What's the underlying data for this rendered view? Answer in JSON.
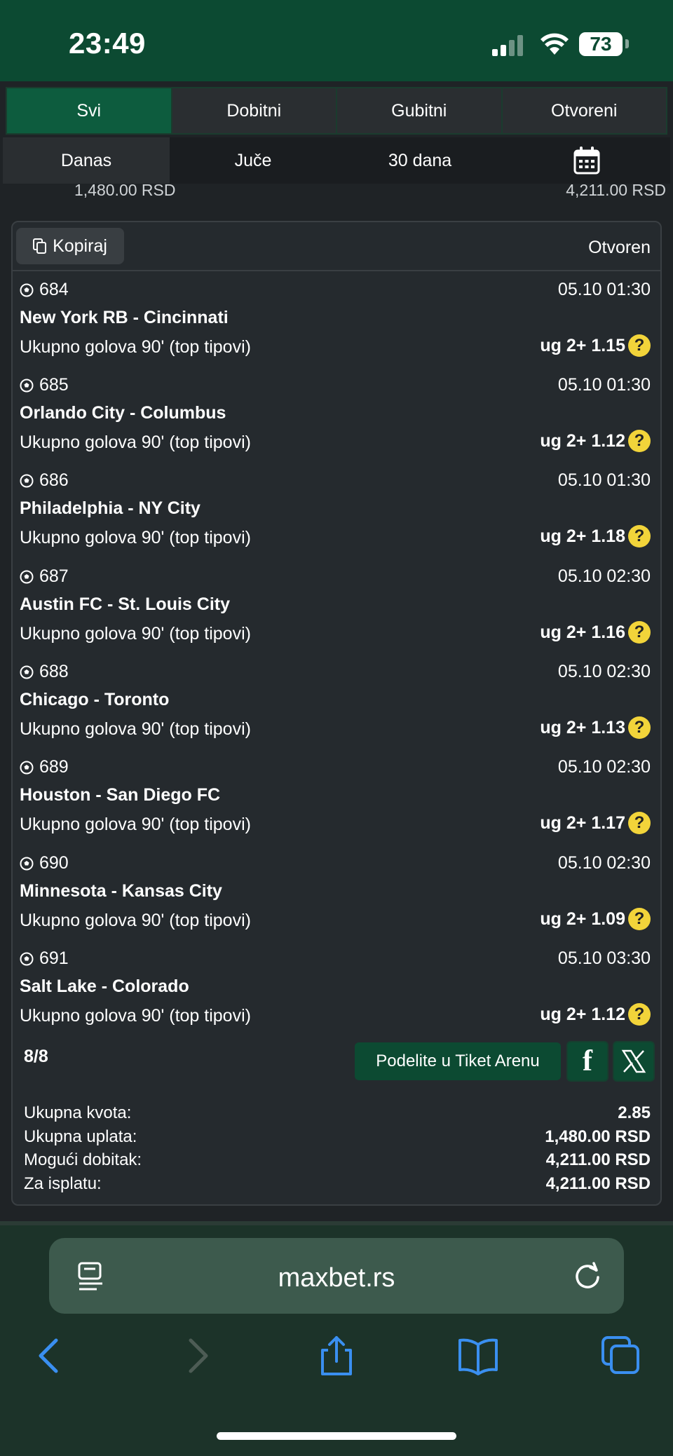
{
  "status_bar": {
    "time": "23:49",
    "battery": "73"
  },
  "tabs": [
    {
      "label": "Svi",
      "active": true
    },
    {
      "label": "Dobitni",
      "active": false
    },
    {
      "label": "Gubitni",
      "active": false
    },
    {
      "label": "Otvoreni",
      "active": false
    }
  ],
  "periods": [
    {
      "label": "Danas"
    },
    {
      "label": "Juče"
    },
    {
      "label": "30 dana"
    }
  ],
  "clipped_amounts": {
    "left": "1,480.00 RSD",
    "right": "4,211.00 RSD"
  },
  "ticket": {
    "copy_label": "Kopiraj",
    "status": "Otvoren",
    "matches": [
      {
        "id": "684",
        "date": "05.10 01:30",
        "teams": "New York RB - Cincinnati",
        "market": "Ukupno golova 90' (top tipovi)",
        "tip": "ug 2+ 1.15"
      },
      {
        "id": "685",
        "date": "05.10 01:30",
        "teams": "Orlando City - Columbus",
        "market": "Ukupno golova 90' (top tipovi)",
        "tip": "ug 2+ 1.12"
      },
      {
        "id": "686",
        "date": "05.10 01:30",
        "teams": "Philadelphia - NY City",
        "market": "Ukupno golova 90' (top tipovi)",
        "tip": "ug 2+ 1.18"
      },
      {
        "id": "687",
        "date": "05.10 02:30",
        "teams": "Austin FC - St. Louis City",
        "market": "Ukupno golova 90' (top tipovi)",
        "tip": "ug 2+ 1.16"
      },
      {
        "id": "688",
        "date": "05.10 02:30",
        "teams": "Chicago - Toronto",
        "market": "Ukupno golova 90' (top tipovi)",
        "tip": "ug 2+ 1.13"
      },
      {
        "id": "689",
        "date": "05.10 02:30",
        "teams": "Houston - San Diego FC",
        "market": "Ukupno golova 90' (top tipovi)",
        "tip": "ug 2+ 1.17"
      },
      {
        "id": "690",
        "date": "05.10 02:30",
        "teams": "Minnesota - Kansas City",
        "market": "Ukupno golova 90' (top tipovi)",
        "tip": "ug 2+ 1.09"
      },
      {
        "id": "691",
        "date": "05.10 03:30",
        "teams": "Salt Lake - Colorado",
        "market": "Ukupno golova 90' (top tipovi)",
        "tip": "ug 2+ 1.12"
      }
    ],
    "count": "8/8",
    "share_label": "Podelite u Tiket Arenu",
    "summary": [
      {
        "label": "Ukupna kvota:",
        "value": "2.85"
      },
      {
        "label": "Ukupna uplata:",
        "value": "1,480.00 RSD"
      },
      {
        "label": "Mogući dobitak:",
        "value": "4,211.00 RSD"
      },
      {
        "label": "Za isplatu:",
        "value": "4,211.00 RSD"
      }
    ]
  },
  "browser": {
    "url": "maxbet.rs"
  },
  "colors": {
    "brand_green": "#0c4a32",
    "active_tab": "#0d5c3e",
    "help_yellow": "#f2d43a",
    "ios_blue": "#3a8ff0"
  },
  "icons": [
    "calendar-icon",
    "copy-icon",
    "soccer-ball-icon",
    "help-icon",
    "facebook-icon",
    "x-icon",
    "reader-icon",
    "reload-icon",
    "back-icon",
    "forward-icon",
    "share-icon",
    "bookmarks-icon",
    "tabs-icon"
  ]
}
